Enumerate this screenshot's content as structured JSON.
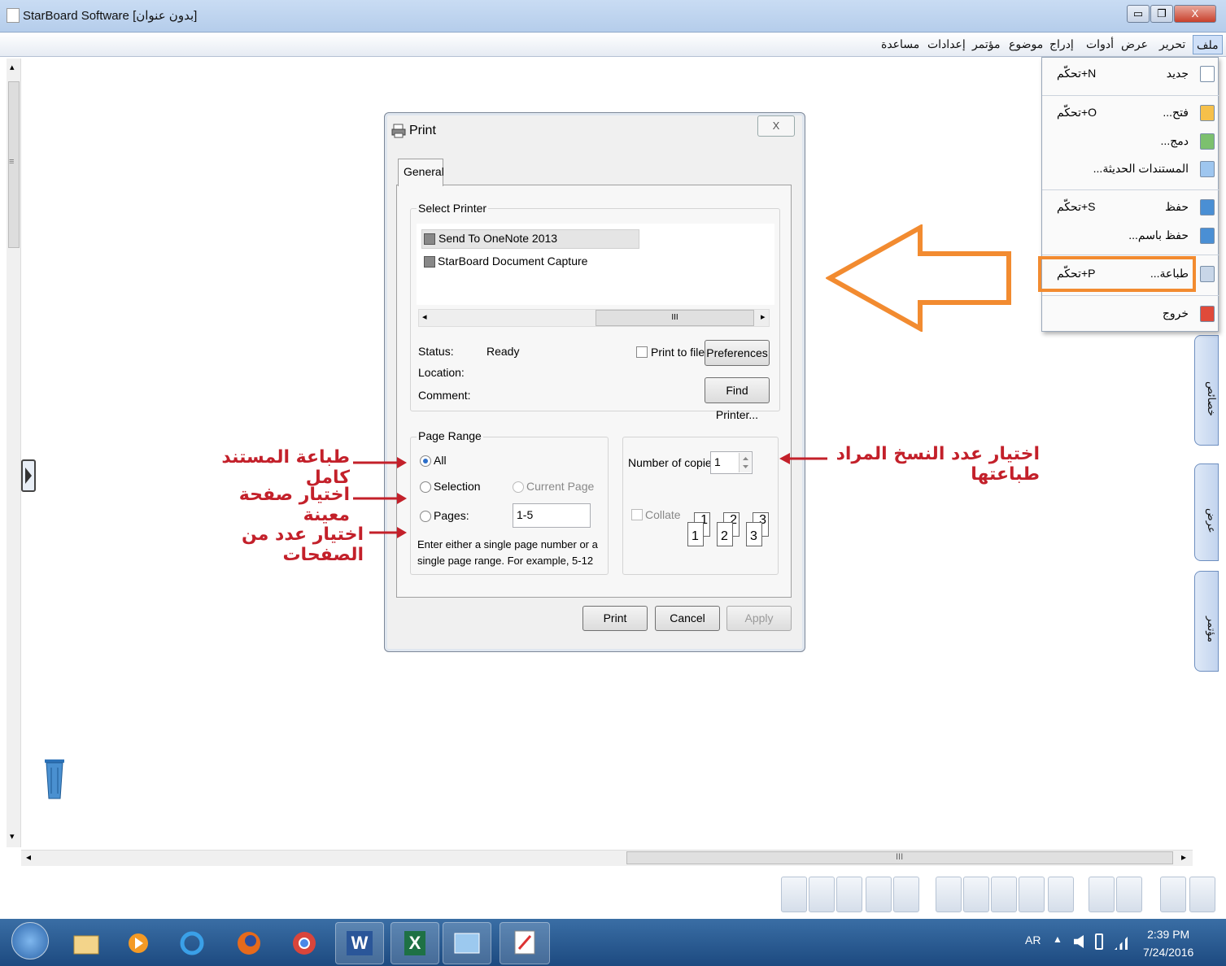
{
  "window": {
    "title": "StarBoard Software [بدون عنوان]",
    "minimize": "▭",
    "restore": "❐",
    "close": "X"
  },
  "menubar": {
    "items": [
      "ملف",
      "تحرير",
      "عرض",
      "أدوات",
      "إدراج",
      "موضوع",
      "مؤتمر",
      "إعدادات",
      "مساعدة"
    ]
  },
  "file_menu": {
    "items": [
      {
        "label": "جديد",
        "shortcut": "تحكّم+N",
        "icon": "new-document-icon"
      },
      {
        "label": "فتح...",
        "shortcut": "تحكّم+O",
        "icon": "open-folder-icon"
      },
      {
        "label": "دمج...",
        "shortcut": "",
        "icon": "merge-icon"
      },
      {
        "label": "المستندات الحديثة...",
        "shortcut": "",
        "icon": "recent-documents-icon"
      },
      {
        "label": "حفظ",
        "shortcut": "تحكّم+S",
        "icon": "save-icon"
      },
      {
        "label": "حفظ باسم...",
        "shortcut": "",
        "icon": "save-as-icon"
      },
      {
        "label": "طباعة...",
        "shortcut": "تحكّم+P",
        "icon": "print-icon"
      },
      {
        "label": "خروج",
        "shortcut": "",
        "icon": "exit-icon"
      }
    ]
  },
  "side_tabs": [
    "خصائص",
    "عرض",
    "مؤتمر"
  ],
  "dialog": {
    "title": "Print",
    "close": "X",
    "tab": "General",
    "select_printer_label": "Select Printer",
    "printers": [
      "Send To OneNote 2013",
      "StarBoard Document Capture"
    ],
    "scroll_grip": "III",
    "status_label": "Status:",
    "status_value": "Ready",
    "location_label": "Location:",
    "comment_label": "Comment:",
    "print_to_file": "Print to file",
    "preferences": "Preferences",
    "find_printer": "Find Printer...",
    "page_range_label": "Page Range",
    "all": "All",
    "selection": "Selection",
    "current_page": "Current Page",
    "pages": "Pages:",
    "pages_value": "1-5",
    "hint": "Enter either a single page number or a single page range.  For example, 5-12",
    "copies_label": "Number of copies:",
    "copies_value": "1",
    "collate": "Collate",
    "collate_pages": [
      "1",
      "1",
      "2",
      "2",
      "3",
      "3"
    ],
    "print": "Print",
    "cancel": "Cancel",
    "apply": "Apply"
  },
  "annotations": {
    "all": "طباعة المستند كامل",
    "selection": "اختيار صفحة معينة",
    "pages": "اختيار عدد من الصفحات",
    "copies": "اختيار عدد النسخ المراد طباعتها"
  },
  "scroll": {
    "h_grip": "III",
    "left": "◂",
    "right": "▸",
    "up": "▴",
    "down": "▾",
    "v_grip": "≡"
  },
  "taskbar": {
    "apps": [
      "start-orb",
      "explorer",
      "media-player",
      "internet-explorer",
      "firefox",
      "chrome",
      "word",
      "excel",
      "photo-viewer",
      "starboard"
    ],
    "word_glyph": "W",
    "excel_glyph": "X",
    "lang": "AR",
    "time": "2:39 PM",
    "date": "7/24/2016"
  },
  "colors": {
    "highlight": "#f28b30",
    "annotation": "#c3202a"
  }
}
